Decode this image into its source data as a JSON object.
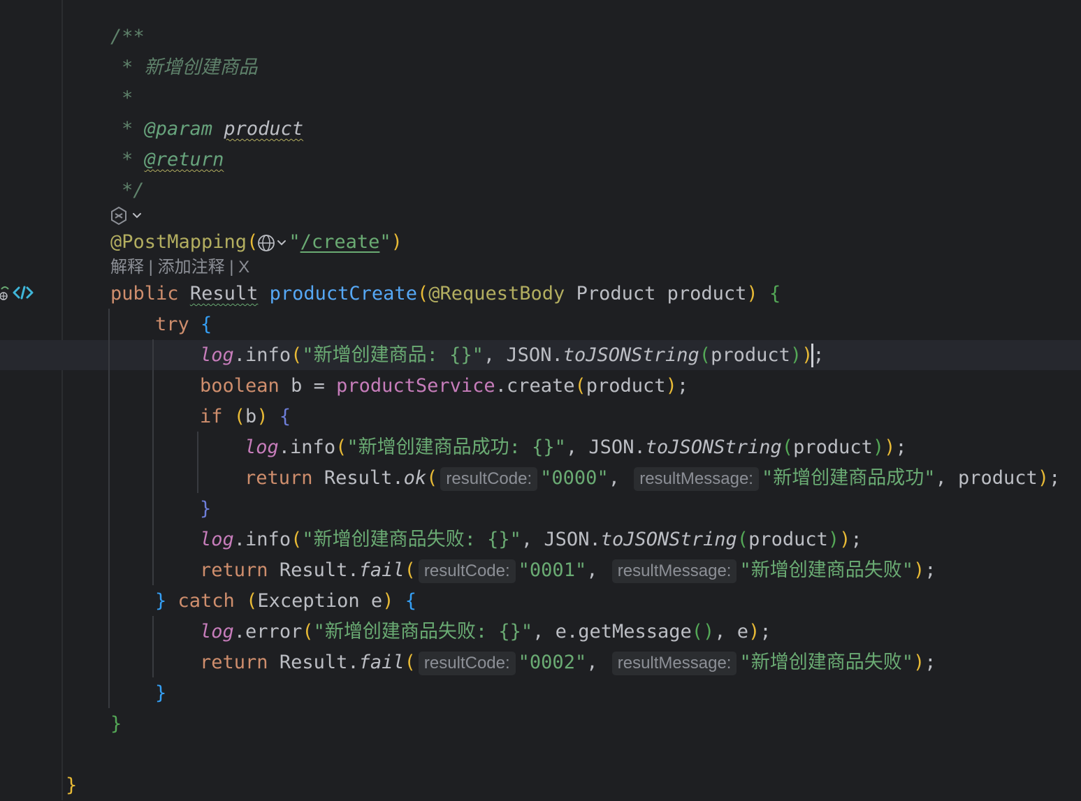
{
  "colors": {
    "background": "#1e1f22",
    "comment": "#5f826b",
    "keyword": "#cf8e6d",
    "function": "#56a8f5",
    "annotation": "#b3ae60",
    "string": "#6aab73",
    "field": "#c77dbb",
    "text": "#bcbec4"
  },
  "icons": {
    "ai_assist": "ai-assist-icon",
    "web_endpoint": "globe-icon",
    "endpoint_gutter": "endpoint-icon"
  },
  "javadoc": {
    "open": "/**",
    "star": "*",
    "description": "新增创建商品",
    "param_tag": "@param",
    "param_name": "product",
    "return_tag": "@return",
    "close": "*/"
  },
  "code_lens": {
    "explain": "解释",
    "sep": " | ",
    "add_comment": "添加注释",
    "close": "X"
  },
  "code": {
    "annotation": "@PostMapping",
    "route": "/create",
    "kw_public": "public",
    "type_result": "Result",
    "method": "productCreate",
    "ann_request_body": "@RequestBody",
    "type_product": "Product",
    "param": "product",
    "kw_try": "try",
    "log": "log",
    "info": "info",
    "error": "error",
    "msg_create": "新增创建商品: {}",
    "msg_success": "新增创建商品成功: {}",
    "msg_fail": "新增创建商品失败: {}",
    "json": "JSON",
    "to_json": "toJSONString",
    "kw_boolean": "boolean",
    "var_b": "b",
    "service": "productService",
    "create": "create",
    "kw_if": "if",
    "kw_return": "return",
    "ok": "ok",
    "fail": "fail",
    "hint_code": "resultCode:",
    "hint_msg": "resultMessage:",
    "code_0000": "0000",
    "code_0001": "0001",
    "code_0002": "0002",
    "text_success": "新增创建商品成功",
    "text_fail": "新增创建商品失败",
    "kw_catch": "catch",
    "type_exception": "Exception",
    "var_e": "e",
    "get_message": "getMessage"
  }
}
